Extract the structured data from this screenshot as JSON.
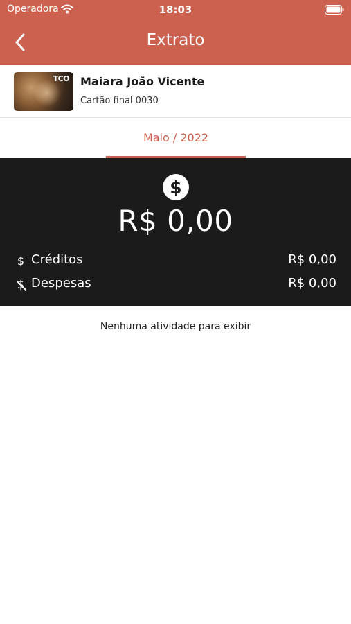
{
  "status_bar": {
    "carrier": "Operadora",
    "time": "18:03",
    "wifi_icon": "wifi-icon",
    "battery_icon": "battery-icon"
  },
  "nav": {
    "title": "Extrato",
    "back_icon": "chevron-left-icon"
  },
  "card": {
    "owner": "Maiara João Vicente",
    "number": "Cartão final 0030",
    "logo_text": "TCO"
  },
  "month_tab": {
    "label": "Maio / 2022"
  },
  "summary": {
    "icon": "dollar-circle-icon",
    "balance": "R$  0,00",
    "credits": {
      "label": "Créditos",
      "value": "R$  0,00",
      "icon": "dollar-icon"
    },
    "expenses": {
      "label": "Despesas",
      "value": "R$  0,00",
      "icon": "dollar-off-icon"
    }
  },
  "empty_message": "Nenhuma atividade para exibir",
  "colors": {
    "accent": "#CC6150",
    "summary_background": "#1B1B1B",
    "background": "#FFFFFF"
  }
}
